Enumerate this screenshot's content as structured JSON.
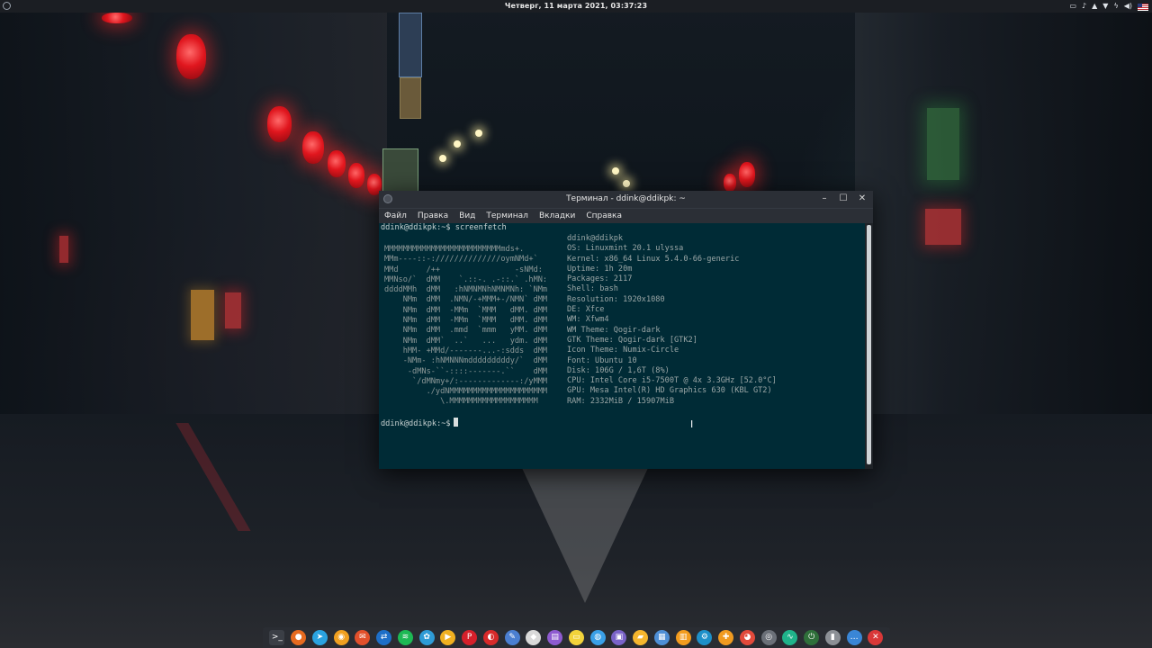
{
  "top_panel": {
    "clock": "Четверг, 11 марта 2021, 03:37:23",
    "tray_icons": [
      "display-icon",
      "bell-icon",
      "notification-icon",
      "wifi-icon",
      "power-icon",
      "volume-icon",
      "flag-us-icon"
    ]
  },
  "terminal": {
    "title": "Терминал - ddink@ddikpk: ~",
    "menu": [
      "Файл",
      "Правка",
      "Вид",
      "Терминал",
      "Вкладки",
      "Справка"
    ],
    "command_line": "ddink@ddikpk:~$ screenfetch",
    "prompt": "ddink@ddikpk:~$",
    "userhost": "ddink@ddikpk",
    "logo_lines": [
      "MMMMMMMMMMMMMMMMMMMMMMMMMmds+.",
      "MMm----::-://////////////oymNMd+`",
      "MMd      /++                -sNMd:",
      "MMNso/`  dMM    `.::-. .-::.` .hMN:",
      "ddddMMh  dMM   :hNMNMNhNMNMNh: `NMm",
      "    NMm  dMM  .NMN/-+MMM+-/NMN` dMM",
      "    NMm  dMM  -MMm  `MMM   dMM. dMM",
      "    NMm  dMM  -MMm  `MMM   dMM. dMM",
      "    NMm  dMM  .mmd  `mmm   yMM. dMM",
      "    NMm  dMM`  ..`   ...   ydm. dMM",
      "    hMM- +MMd/-------...-:sdds  dMM",
      "    -NMm- :hNMNNNmdddddddddy/`  dMM",
      "     -dMNs-``-::::-------.``    dMM",
      "      `/dMNmy+/:-------------:/yMMM",
      "         ./ydNMMMMMMMMMMMMMMMMMMMMM",
      "            \\.MMMMMMMMMMMMMMMMMMM"
    ],
    "info": [
      {
        "label": "OS:",
        "value": "Linuxmint 20.1 ulyssa"
      },
      {
        "label": "Kernel:",
        "value": "x86_64 Linux 5.4.0-66-generic"
      },
      {
        "label": "Uptime:",
        "value": "1h 20m"
      },
      {
        "label": "Packages:",
        "value": "2117"
      },
      {
        "label": "Shell:",
        "value": "bash"
      },
      {
        "label": "Resolution:",
        "value": "1920x1080"
      },
      {
        "label": "DE:",
        "value": "Xfce"
      },
      {
        "label": "WM:",
        "value": "Xfwm4"
      },
      {
        "label": "WM Theme:",
        "value": "Qogir-dark"
      },
      {
        "label": "GTK Theme:",
        "value": "Qogir-dark [GTK2]"
      },
      {
        "label": "Icon Theme:",
        "value": "Numix-Circle"
      },
      {
        "label": "Font:",
        "value": "Ubuntu 10"
      },
      {
        "label": "Disk:",
        "value": "106G / 1,6T (8%)"
      },
      {
        "label": "CPU:",
        "value": "Intel Core i5-7500T @ 4x 3.3GHz [52.0°C]"
      },
      {
        "label": "GPU:",
        "value": "Mesa Intel(R) HD Graphics 630 (KBL GT2)"
      },
      {
        "label": "RAM:",
        "value": "2332MiB / 15907MiB"
      }
    ],
    "colors": {
      "background": "#002b36",
      "text": "#93a1a1"
    }
  },
  "dock": {
    "items": [
      {
        "name": "terminal-icon",
        "glyph": ">_",
        "color": "#3b3f46"
      },
      {
        "name": "firefox-icon",
        "glyph": "●",
        "color": "#e66a1f"
      },
      {
        "name": "telegram-icon",
        "glyph": "➤",
        "color": "#2aa3e0"
      },
      {
        "name": "app-orange-icon",
        "glyph": "◉",
        "color": "#f0a020"
      },
      {
        "name": "mail-icon",
        "glyph": "✉",
        "color": "#e2502b"
      },
      {
        "name": "sync-icon",
        "glyph": "⇄",
        "color": "#1e6fc8"
      },
      {
        "name": "spotify-icon",
        "glyph": "≋",
        "color": "#1db954"
      },
      {
        "name": "pinwheel-icon",
        "glyph": "✿",
        "color": "#2e9bd6"
      },
      {
        "name": "media-player-icon",
        "glyph": "▶",
        "color": "#f0b020"
      },
      {
        "name": "pinterest-icon",
        "glyph": "P",
        "color": "#d5202b"
      },
      {
        "name": "record-icon",
        "glyph": "◐",
        "color": "#d72a2a"
      },
      {
        "name": "pen-icon",
        "glyph": "✎",
        "color": "#4b7fd1"
      },
      {
        "name": "eraser-icon",
        "glyph": "◆",
        "color": "#d9d9d9"
      },
      {
        "name": "document-icon",
        "glyph": "▤",
        "color": "#8e5bd0"
      },
      {
        "name": "notes-icon",
        "glyph": "▭",
        "color": "#f2d33b"
      },
      {
        "name": "globe-icon",
        "glyph": "◍",
        "color": "#3aa0e8"
      },
      {
        "name": "archive-icon",
        "glyph": "▣",
        "color": "#7a63c8"
      },
      {
        "name": "folder-icon",
        "glyph": "▰",
        "color": "#f5b62e"
      },
      {
        "name": "calendar-icon",
        "glyph": "▦",
        "color": "#4e8fd6"
      },
      {
        "name": "files-icon",
        "glyph": "▥",
        "color": "#f39c1e"
      },
      {
        "name": "settings-icon",
        "glyph": "⚙",
        "color": "#1e90c9"
      },
      {
        "name": "tools-icon",
        "glyph": "✚",
        "color": "#f09a20"
      },
      {
        "name": "color-picker-icon",
        "glyph": "◕",
        "color": "#e24a3b"
      },
      {
        "name": "disk-icon",
        "glyph": "◎",
        "color": "#6b7078"
      },
      {
        "name": "monitor-icon",
        "glyph": "∿",
        "color": "#1fb38a"
      },
      {
        "name": "power-icon",
        "glyph": "⏻",
        "color": "#2f6f3a"
      },
      {
        "name": "trash-icon",
        "glyph": "▮",
        "color": "#8c9096"
      },
      {
        "name": "chat-icon",
        "glyph": "…",
        "color": "#3a86d6"
      },
      {
        "name": "exit-icon",
        "glyph": "✕",
        "color": "#d93838"
      }
    ]
  }
}
